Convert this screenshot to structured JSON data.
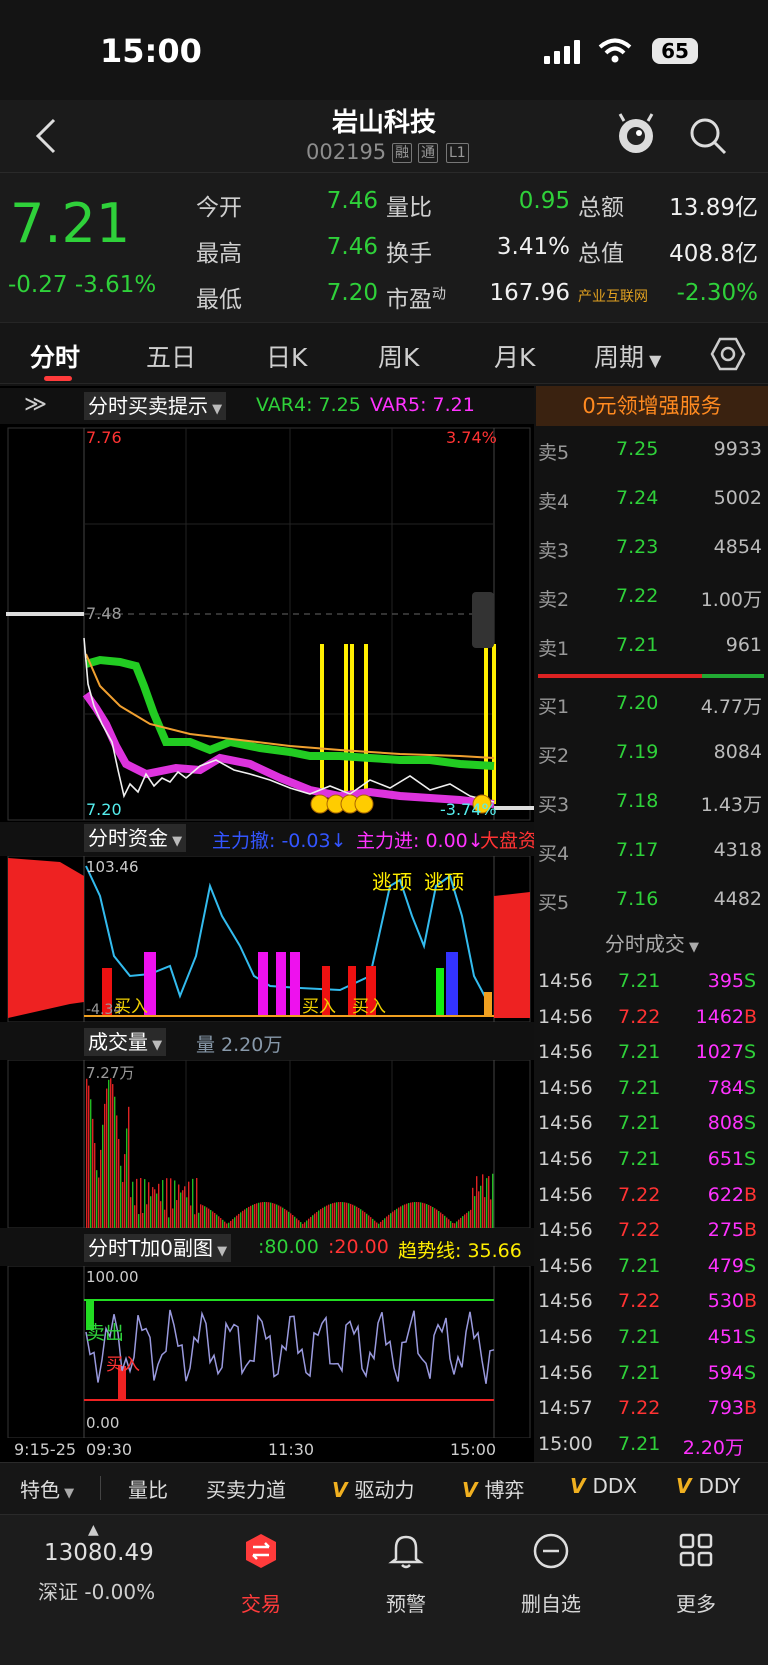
{
  "status": {
    "time": "15:00",
    "battery": "65"
  },
  "stock": {
    "name": "岩山科技",
    "code": "002195",
    "tags": [
      "融",
      "通",
      "L1"
    ]
  },
  "quote": {
    "price": "7.21",
    "change": "-0.27",
    "change_pct": "-3.61%",
    "col1": [
      {
        "label": "今开",
        "value": "7.46"
      },
      {
        "label": "最高",
        "value": "7.46"
      },
      {
        "label": "最低",
        "value": "7.20"
      }
    ],
    "col2": [
      {
        "label": "量比",
        "value": "0.95"
      },
      {
        "label": "换手",
        "value": "3.41%"
      },
      {
        "label": "市盈",
        "sup": "动",
        "value": "167.96"
      }
    ],
    "col3": [
      {
        "label": "总额",
        "value": "13.89亿"
      },
      {
        "label": "总值",
        "value": "408.8亿"
      },
      {
        "label": "产业互联网",
        "value": "-2.30%"
      }
    ]
  },
  "tabs": [
    "分时",
    "五日",
    "日K",
    "周K",
    "月K",
    "周期"
  ],
  "panel1": {
    "title": "分时买卖提示",
    "var4": "VAR4: 7.25",
    "var5": "VAR5: 7.21",
    "top_price": "7.76",
    "top_pct": "3.74%",
    "mid_price": "7.48",
    "bottom_price": "7.20",
    "bottom_pct": "-3.74%"
  },
  "panel2": {
    "title": "分时资金",
    "main_out": "主力撤: -0.03↓",
    "main_in": "主力进: 0.00↓",
    "market": "大盘资",
    "top": "103.46",
    "bottom": "-4.34",
    "tip1": "逃顶",
    "tip2": "逃顶",
    "buy_label": "买入"
  },
  "panel3": {
    "title": "成交量",
    "vol": "量 2.20万",
    "max": "7.27万"
  },
  "panel4": {
    "title": "分时T加0副图",
    "v80": ":80.00",
    "v20": ":20.00",
    "trend": "趋势线: 35.66",
    "top": "100.00",
    "bottom": "0.00",
    "sell": "卖出",
    "buy": "买入"
  },
  "xaxis": [
    "9:15-25",
    "09:30",
    "11:30",
    "15:00"
  ],
  "promo": "0元领增强服务",
  "orderbook": {
    "asks": [
      {
        "label": "卖5",
        "price": "7.25",
        "vol": "9933"
      },
      {
        "label": "卖4",
        "price": "7.24",
        "vol": "5002"
      },
      {
        "label": "卖3",
        "price": "7.23",
        "vol": "4854"
      },
      {
        "label": "卖2",
        "price": "7.22",
        "vol": "1.00万"
      },
      {
        "label": "卖1",
        "price": "7.21",
        "vol": "961"
      }
    ],
    "bids": [
      {
        "label": "买1",
        "price": "7.20",
        "vol": "4.77万"
      },
      {
        "label": "买2",
        "price": "7.19",
        "vol": "8084"
      },
      {
        "label": "买3",
        "price": "7.18",
        "vol": "1.43万"
      },
      {
        "label": "买4",
        "price": "7.17",
        "vol": "4318"
      },
      {
        "label": "买5",
        "price": "7.16",
        "vol": "4482"
      }
    ]
  },
  "trades_title": "分时成交",
  "trades": [
    {
      "t": "14:56",
      "p": "7.21",
      "v": "395",
      "s": "S"
    },
    {
      "t": "14:56",
      "p": "7.22",
      "v": "1462",
      "s": "B"
    },
    {
      "t": "14:56",
      "p": "7.21",
      "v": "1027",
      "s": "S"
    },
    {
      "t": "14:56",
      "p": "7.21",
      "v": "784",
      "s": "S"
    },
    {
      "t": "14:56",
      "p": "7.21",
      "v": "808",
      "s": "S"
    },
    {
      "t": "14:56",
      "p": "7.21",
      "v": "651",
      "s": "S"
    },
    {
      "t": "14:56",
      "p": "7.22",
      "v": "622",
      "s": "B"
    },
    {
      "t": "14:56",
      "p": "7.22",
      "v": "275",
      "s": "B"
    },
    {
      "t": "14:56",
      "p": "7.21",
      "v": "479",
      "s": "S"
    },
    {
      "t": "14:56",
      "p": "7.22",
      "v": "530",
      "s": "B"
    },
    {
      "t": "14:56",
      "p": "7.21",
      "v": "451",
      "s": "S"
    },
    {
      "t": "14:56",
      "p": "7.21",
      "v": "594",
      "s": "S"
    },
    {
      "t": "14:57",
      "p": "7.22",
      "v": "793",
      "s": "B"
    },
    {
      "t": "15:00",
      "p": "7.21",
      "v": "2.20万",
      "s": ""
    }
  ],
  "toolbar": [
    "特色",
    "量比",
    "买卖力道",
    "驱动力",
    "博弈",
    "DDX",
    "DDY"
  ],
  "nav": {
    "index_value": "13080.49",
    "index_label": "深证 -0.00%",
    "items": [
      "交易",
      "预警",
      "删自选",
      "更多"
    ]
  }
}
